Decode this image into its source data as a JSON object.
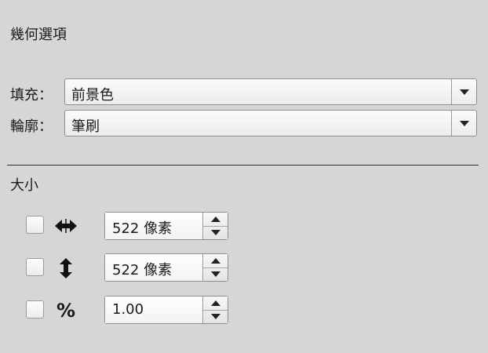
{
  "panel": {
    "title": "幾何選項",
    "fill": {
      "label": "填充：",
      "value": "前景色"
    },
    "outline": {
      "label": "輪廓：",
      "value": "筆刷"
    },
    "size": {
      "label": "大小",
      "rows": [
        {
          "icon": "horizontal-resize-icon",
          "value": "522 像素"
        },
        {
          "icon": "vertical-resize-icon",
          "value": "522 像素"
        },
        {
          "icon": "percent-icon",
          "glyph": "%",
          "value": "1.00"
        }
      ]
    }
  }
}
